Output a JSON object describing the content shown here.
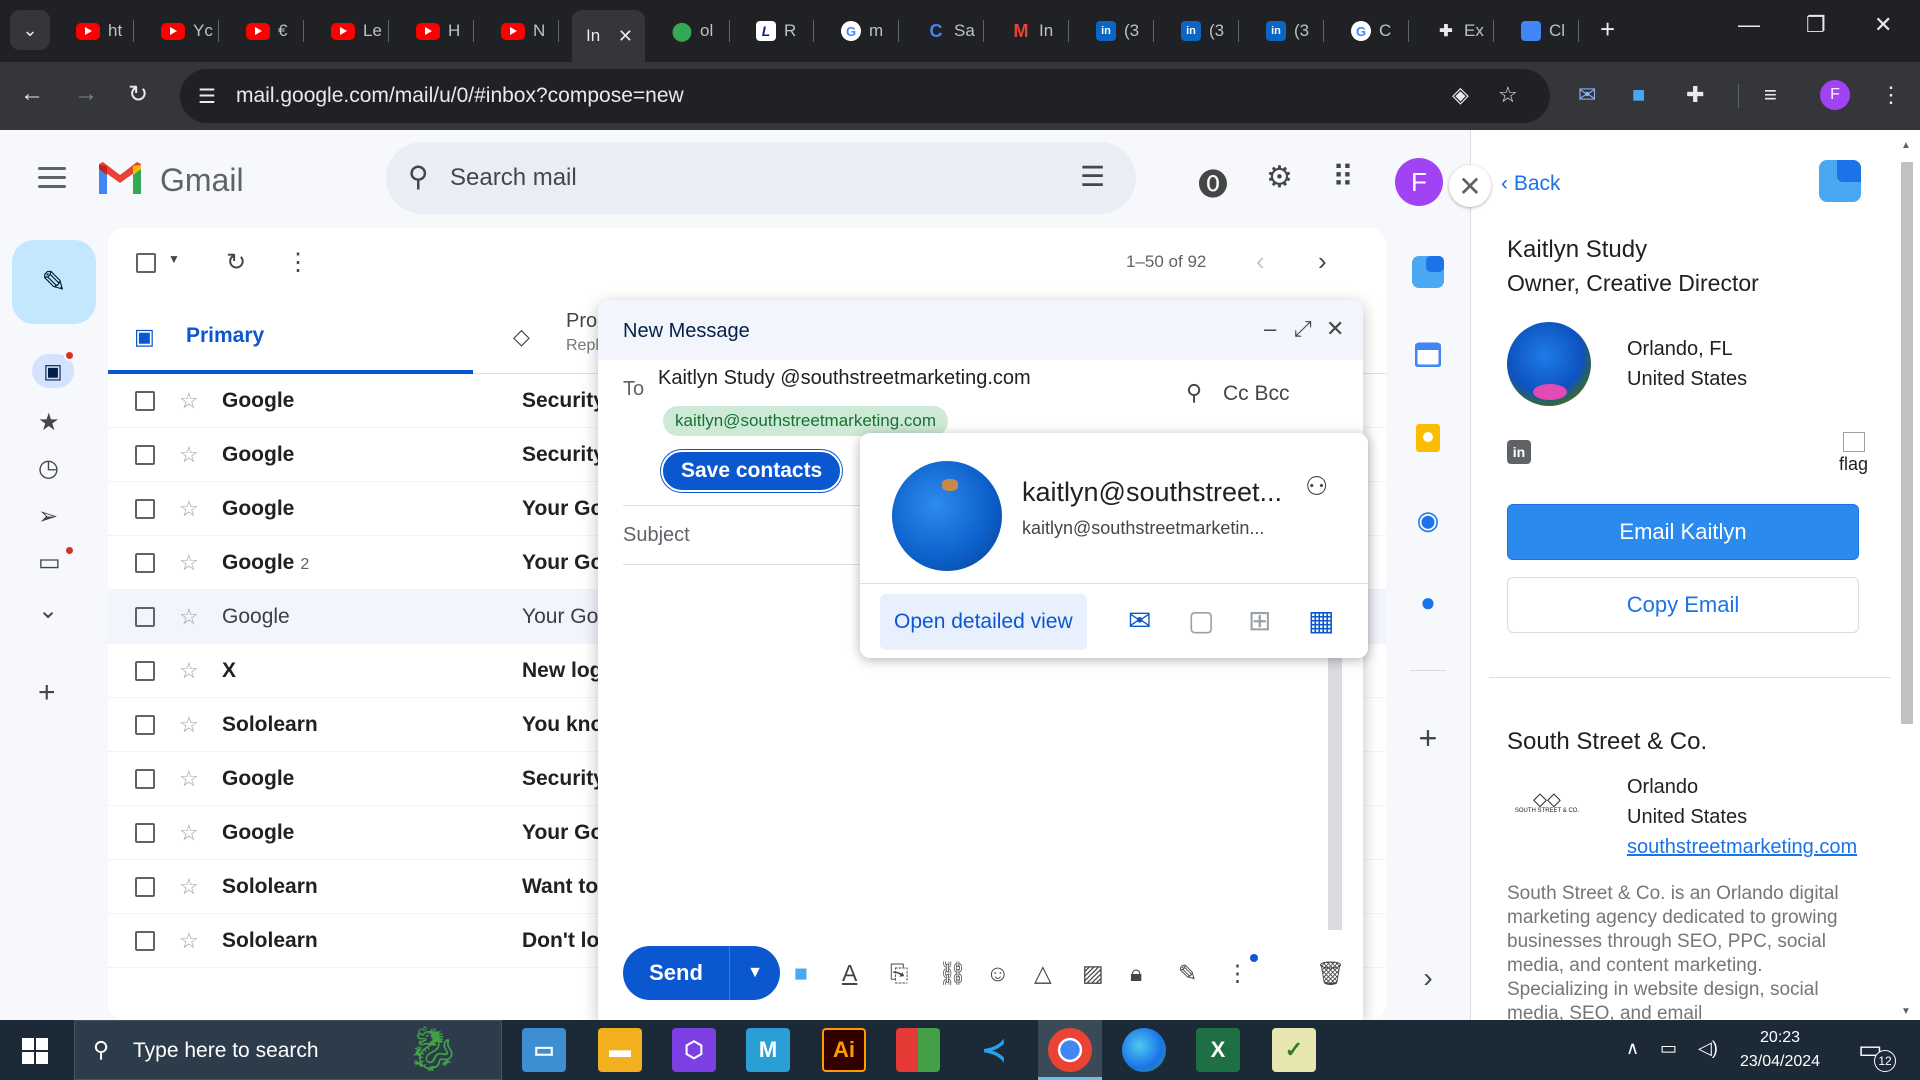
{
  "browser": {
    "tabs": [
      {
        "label": "ht",
        "icon": "youtube-icon"
      },
      {
        "label": "Yc",
        "icon": "youtube-icon"
      },
      {
        "label": "€",
        "icon": "youtube-icon"
      },
      {
        "label": "Le",
        "icon": "youtube-icon"
      },
      {
        "label": "H",
        "icon": "youtube-icon"
      },
      {
        "label": "N",
        "icon": "youtube-icon"
      },
      {
        "label": "In",
        "icon": "gmail-icon",
        "active": true
      },
      {
        "label": "ol",
        "icon": "maps-icon"
      },
      {
        "label": "R",
        "icon": "l-icon"
      },
      {
        "label": "m",
        "icon": "google-icon"
      },
      {
        "label": "Sa",
        "icon": "c-icon"
      },
      {
        "label": "In",
        "icon": "gmail-icon"
      },
      {
        "label": "(3",
        "icon": "linkedin-icon"
      },
      {
        "label": "(3",
        "icon": "linkedin-icon"
      },
      {
        "label": "(3",
        "icon": "linkedin-icon"
      },
      {
        "label": "C",
        "icon": "google-icon"
      },
      {
        "label": "Ex",
        "icon": "puzzle-icon"
      },
      {
        "label": "Cl",
        "icon": "box-icon"
      }
    ],
    "url": "mail.google.com/mail/u/0/#inbox?compose=new",
    "profile_initial": "F"
  },
  "gmail": {
    "brand": "Gmail",
    "search_placeholder": "Search mail",
    "account_initial": "F",
    "pager": "1–50 of 92",
    "tabs": {
      "primary": "Primary",
      "promotions": "Pro",
      "promotions_sub": "Repl"
    },
    "rows": [
      {
        "sender": "Google",
        "count": "",
        "subject": "Security",
        "read": false
      },
      {
        "sender": "Google",
        "count": "",
        "subject": "Security",
        "read": false
      },
      {
        "sender": "Google",
        "count": "",
        "subject": "Your Go",
        "read": false
      },
      {
        "sender": "Google",
        "count": "2",
        "subject": "Your Go",
        "read": false
      },
      {
        "sender": "Google",
        "count": "",
        "subject": "Your Goo",
        "read": true
      },
      {
        "sender": "X",
        "count": "",
        "subject": "New log",
        "read": false
      },
      {
        "sender": "Sololearn",
        "count": "",
        "subject": "You kno",
        "read": false
      },
      {
        "sender": "Google",
        "count": "",
        "subject": "Security",
        "read": false
      },
      {
        "sender": "Google",
        "count": "",
        "subject": "Your Go",
        "read": false
      },
      {
        "sender": "Sololearn",
        "count": "",
        "subject": "Want to",
        "read": false
      },
      {
        "sender": "Sololearn",
        "count": "",
        "subject": "Don't lo",
        "read": false
      }
    ]
  },
  "compose": {
    "title": "New Message",
    "to_label": "To",
    "to_name": "Kaitlyn Study @southstreetmarketing.com",
    "cc_bcc": "Cc Bcc",
    "chip_email": "kaitlyn@southstreetmarketing.com",
    "save_contacts": "Save contacts",
    "subject_placeholder": "Subject",
    "send_label": "Send"
  },
  "hovercard": {
    "name": "kaitlyn@southstreet...",
    "email": "kaitlyn@southstreetmarketin...",
    "open_detailed": "Open detailed view"
  },
  "side_panel": {
    "back": "Back",
    "name": "Kaitlyn Study",
    "title": "Owner, Creative Director",
    "city": "Orlando, FL",
    "country": "United States",
    "flag_alt": "flag",
    "email_button": "Email Kaitlyn",
    "copy_button": "Copy Email",
    "company": "South Street & Co.",
    "company_city": "Orlando",
    "company_country": "United States",
    "company_site": "southstreetmarketing.com",
    "company_logo_text": "SOUTH STREET & CO.",
    "description": "South Street & Co. is an Orlando digital marketing agency dedicated to growing businesses through SEO, PPC, social media, and content marketing. Specializing in website design, social media, SEO, and email"
  },
  "taskbar": {
    "search_placeholder": "Type here to search",
    "time": "20:23",
    "date": "23/04/2024",
    "notifications": "12"
  },
  "colors": {
    "gmail_blue": "#0b57d0",
    "compose_btn": "#c2e7ff",
    "side_email_btn": "#2b8aee",
    "chip_bg": "#ceead6"
  }
}
